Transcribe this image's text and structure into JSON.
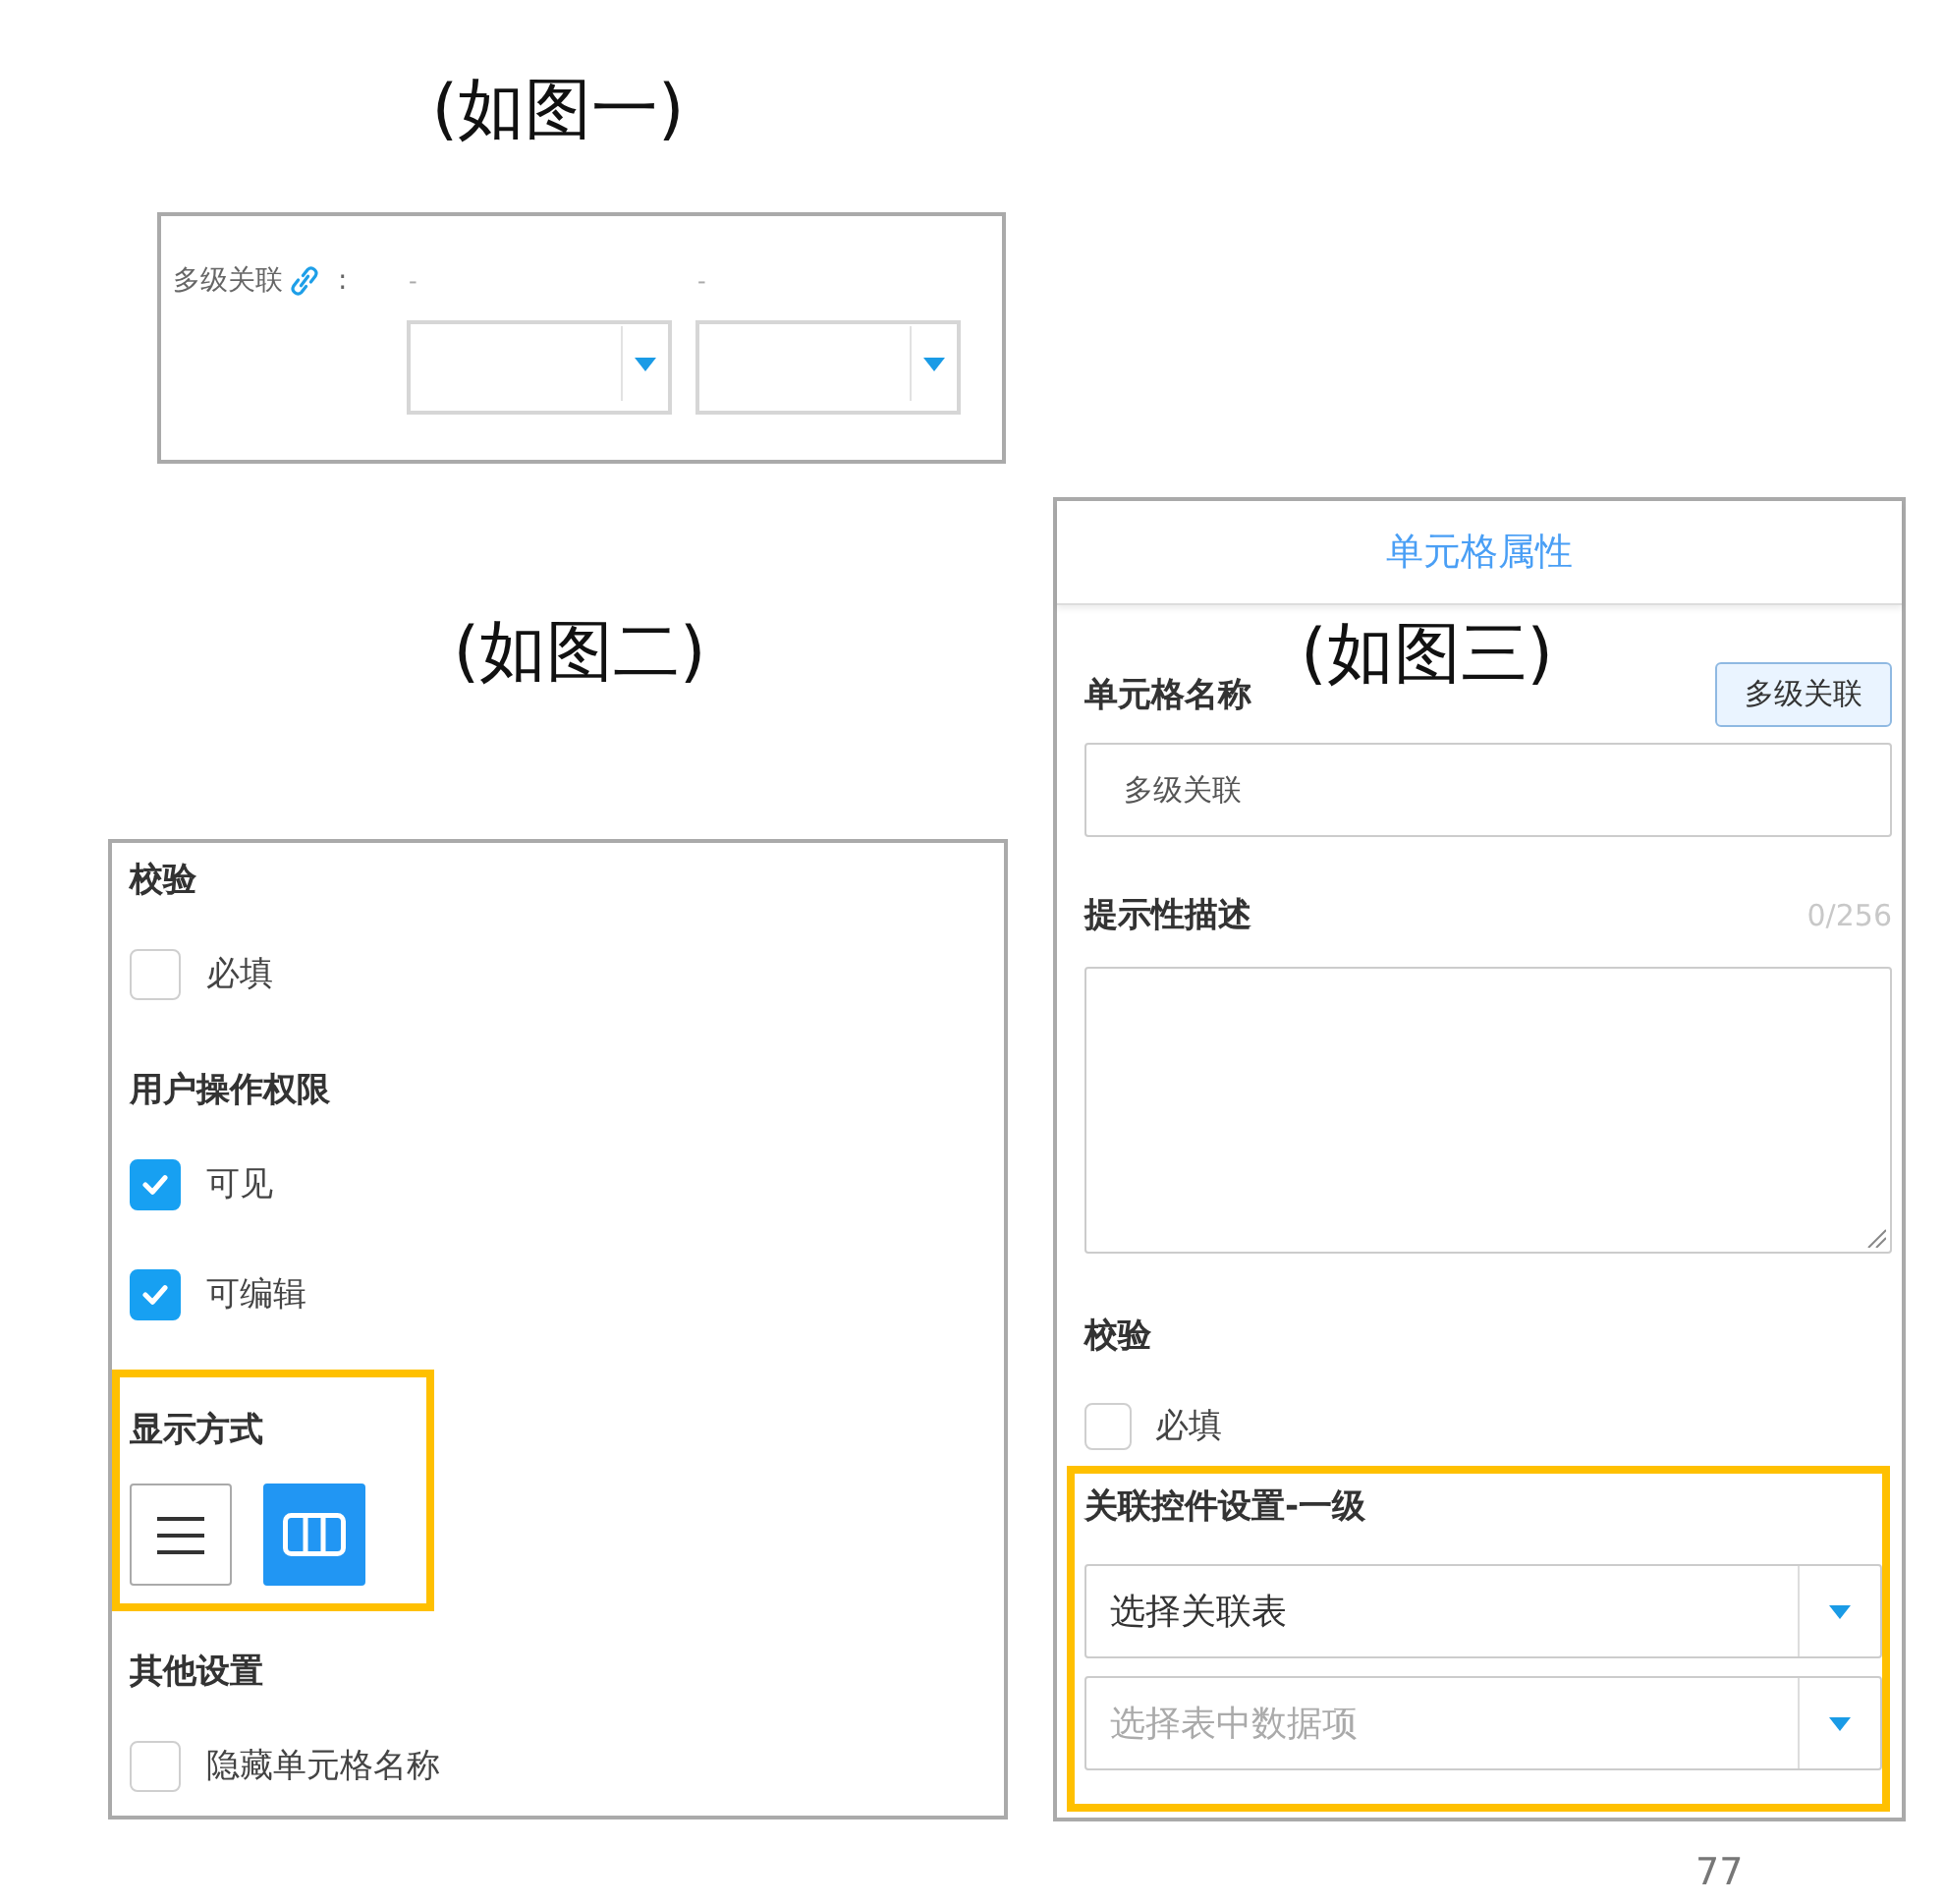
{
  "figure_1": {
    "caption": "(如图一)",
    "label": "多级关联",
    "colon": ":",
    "levels": [
      {
        "separator": "-"
      },
      {
        "separator": "-"
      }
    ]
  },
  "figure_2": {
    "caption": "(如图二)",
    "sections": [
      {
        "kind": "checkboxes",
        "title": "校验",
        "highlighted": false,
        "items": [
          {
            "label": "必填",
            "checked": false
          }
        ]
      },
      {
        "kind": "checkboxes",
        "title": "用户操作权限",
        "highlighted": false,
        "items": [
          {
            "label": "可见",
            "checked": true
          },
          {
            "label": "可编辑",
            "checked": true
          }
        ]
      },
      {
        "kind": "view_modes",
        "title": "显示方式",
        "highlighted": true,
        "modes": [
          {
            "kind": "list",
            "selected": false
          },
          {
            "kind": "columns",
            "selected": true
          }
        ]
      },
      {
        "kind": "checkboxes",
        "title": "其他设置",
        "highlighted": false,
        "items": [
          {
            "label": "隐藏单元格名称",
            "checked": false
          }
        ]
      }
    ]
  },
  "figure_3": {
    "caption": "(如图三)",
    "title": "单元格属性",
    "name_field": {
      "label": "单元格名称",
      "tag_button": "多级关联",
      "value": "多级关联"
    },
    "description_field": {
      "label": "提示性描述",
      "counter": "0/256"
    },
    "validation": {
      "title": "校验",
      "items": [
        {
          "label": "必填",
          "checked": false
        }
      ]
    },
    "link_settings": {
      "title": "关联控件设置-一级",
      "highlighted": true,
      "selects": [
        {
          "value": "选择关联表"
        },
        {
          "placeholder": "选择表中数据项"
        }
      ]
    }
  },
  "page_number": "77"
}
